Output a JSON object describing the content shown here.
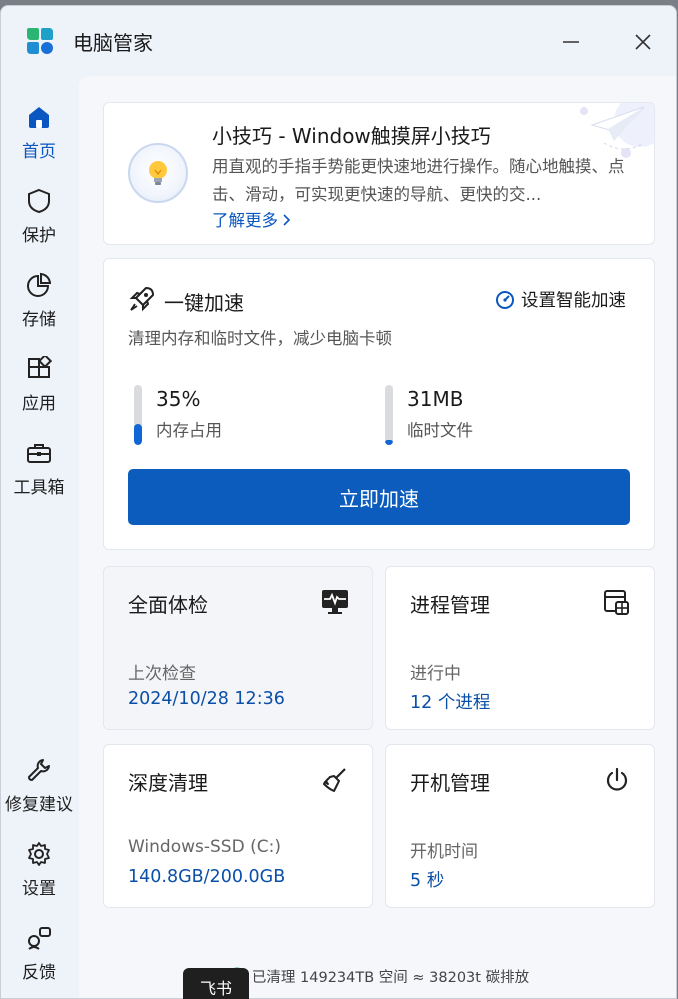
{
  "app": {
    "title": "电脑管家"
  },
  "colors": {
    "accent": "#0b5cbd",
    "link": "#0a57c2",
    "value": "#0a4fa8"
  },
  "sidebar": {
    "items": [
      {
        "label": "首页",
        "icon": "home-icon",
        "active": true
      },
      {
        "label": "保护",
        "icon": "shield-icon",
        "active": false
      },
      {
        "label": "存储",
        "icon": "pie-chart-icon",
        "active": false
      },
      {
        "label": "应用",
        "icon": "apps-icon",
        "active": false
      },
      {
        "label": "工具箱",
        "icon": "toolbox-icon",
        "active": false
      }
    ],
    "bottom_items": [
      {
        "label": "修复建议",
        "icon": "wrench-icon"
      },
      {
        "label": "设置",
        "icon": "gear-icon"
      },
      {
        "label": "反馈",
        "icon": "feedback-icon"
      }
    ]
  },
  "tip": {
    "title": "小技巧 - Window触摸屏小技巧",
    "description": "用直观的手指手势能更快速地进行操作。随心地触摸、点击、滑动，可实现更快速的导航、更快的交...",
    "more_label": "了解更多",
    "icon": "lightbulb-icon"
  },
  "speedup": {
    "title": "一键加速",
    "smart_label": "设置智能加速",
    "description": "清理内存和临时文件，减少电脑卡顿",
    "memory": {
      "value": "35%",
      "label": "内存占用",
      "fill": 0.35
    },
    "temp": {
      "value": "31MB",
      "label": "临时文件",
      "fill": 0.08
    },
    "button_label": "立即加速"
  },
  "tiles": [
    {
      "title": "全面体检",
      "label": "上次检查",
      "value": "2024/10/28 12:36",
      "icon": "monitor-pulse-icon"
    },
    {
      "title": "进程管理",
      "label": "进行中",
      "value": "12 个进程",
      "icon": "process-window-icon"
    },
    {
      "title": "深度清理",
      "label": "Windows-SSD (C:)",
      "value": "140.8GB/200.0GB",
      "icon": "broom-icon"
    },
    {
      "title": "开机管理",
      "label": "开机时间",
      "value": "5 秒",
      "icon": "power-icon"
    }
  ],
  "footer": {
    "text": "已清理 149234TB 空间 ≈ 38203t 碳排放"
  },
  "tooltip": {
    "text": "飞书"
  }
}
